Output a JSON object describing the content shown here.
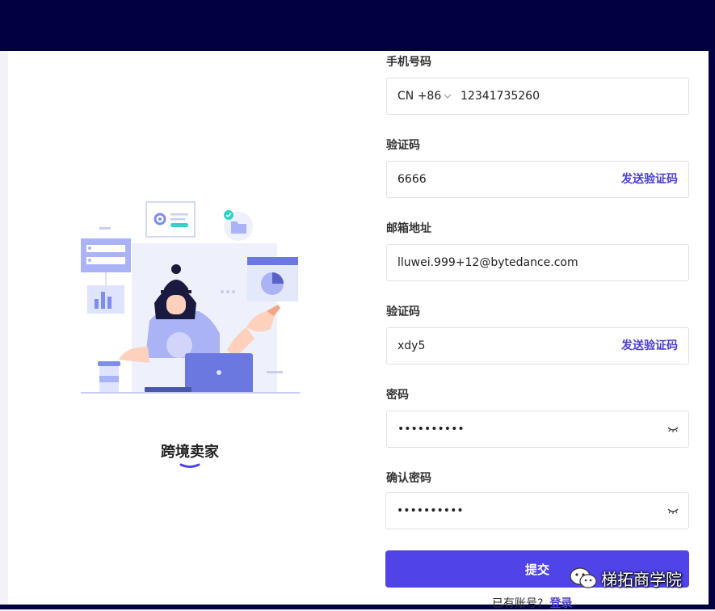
{
  "brand": {
    "title": "跨境卖家"
  },
  "form": {
    "phone": {
      "label": "手机号码",
      "country_code": "CN +86",
      "value": "12341735260"
    },
    "phone_code": {
      "label": "验证码",
      "value": "6666",
      "send_label": "发送验证码"
    },
    "email": {
      "label": "邮箱地址",
      "value": "lluwei.999+12@bytedance.com"
    },
    "email_code": {
      "label": "验证码",
      "value": "xdy5",
      "send_label": "发送验证码"
    },
    "password": {
      "label": "密码",
      "value": "••••••••••"
    },
    "confirm_password": {
      "label": "确认密码",
      "value": "••••••••••"
    },
    "submit_label": "提交",
    "has_account_text": "已有账号?",
    "login_label": "登录"
  },
  "watermark": {
    "text": "梯拓商学院"
  },
  "colors": {
    "accent": "#5043e8",
    "link": "#4a3fc9",
    "frame": "#010140",
    "illustration": "#a9b3f5"
  }
}
